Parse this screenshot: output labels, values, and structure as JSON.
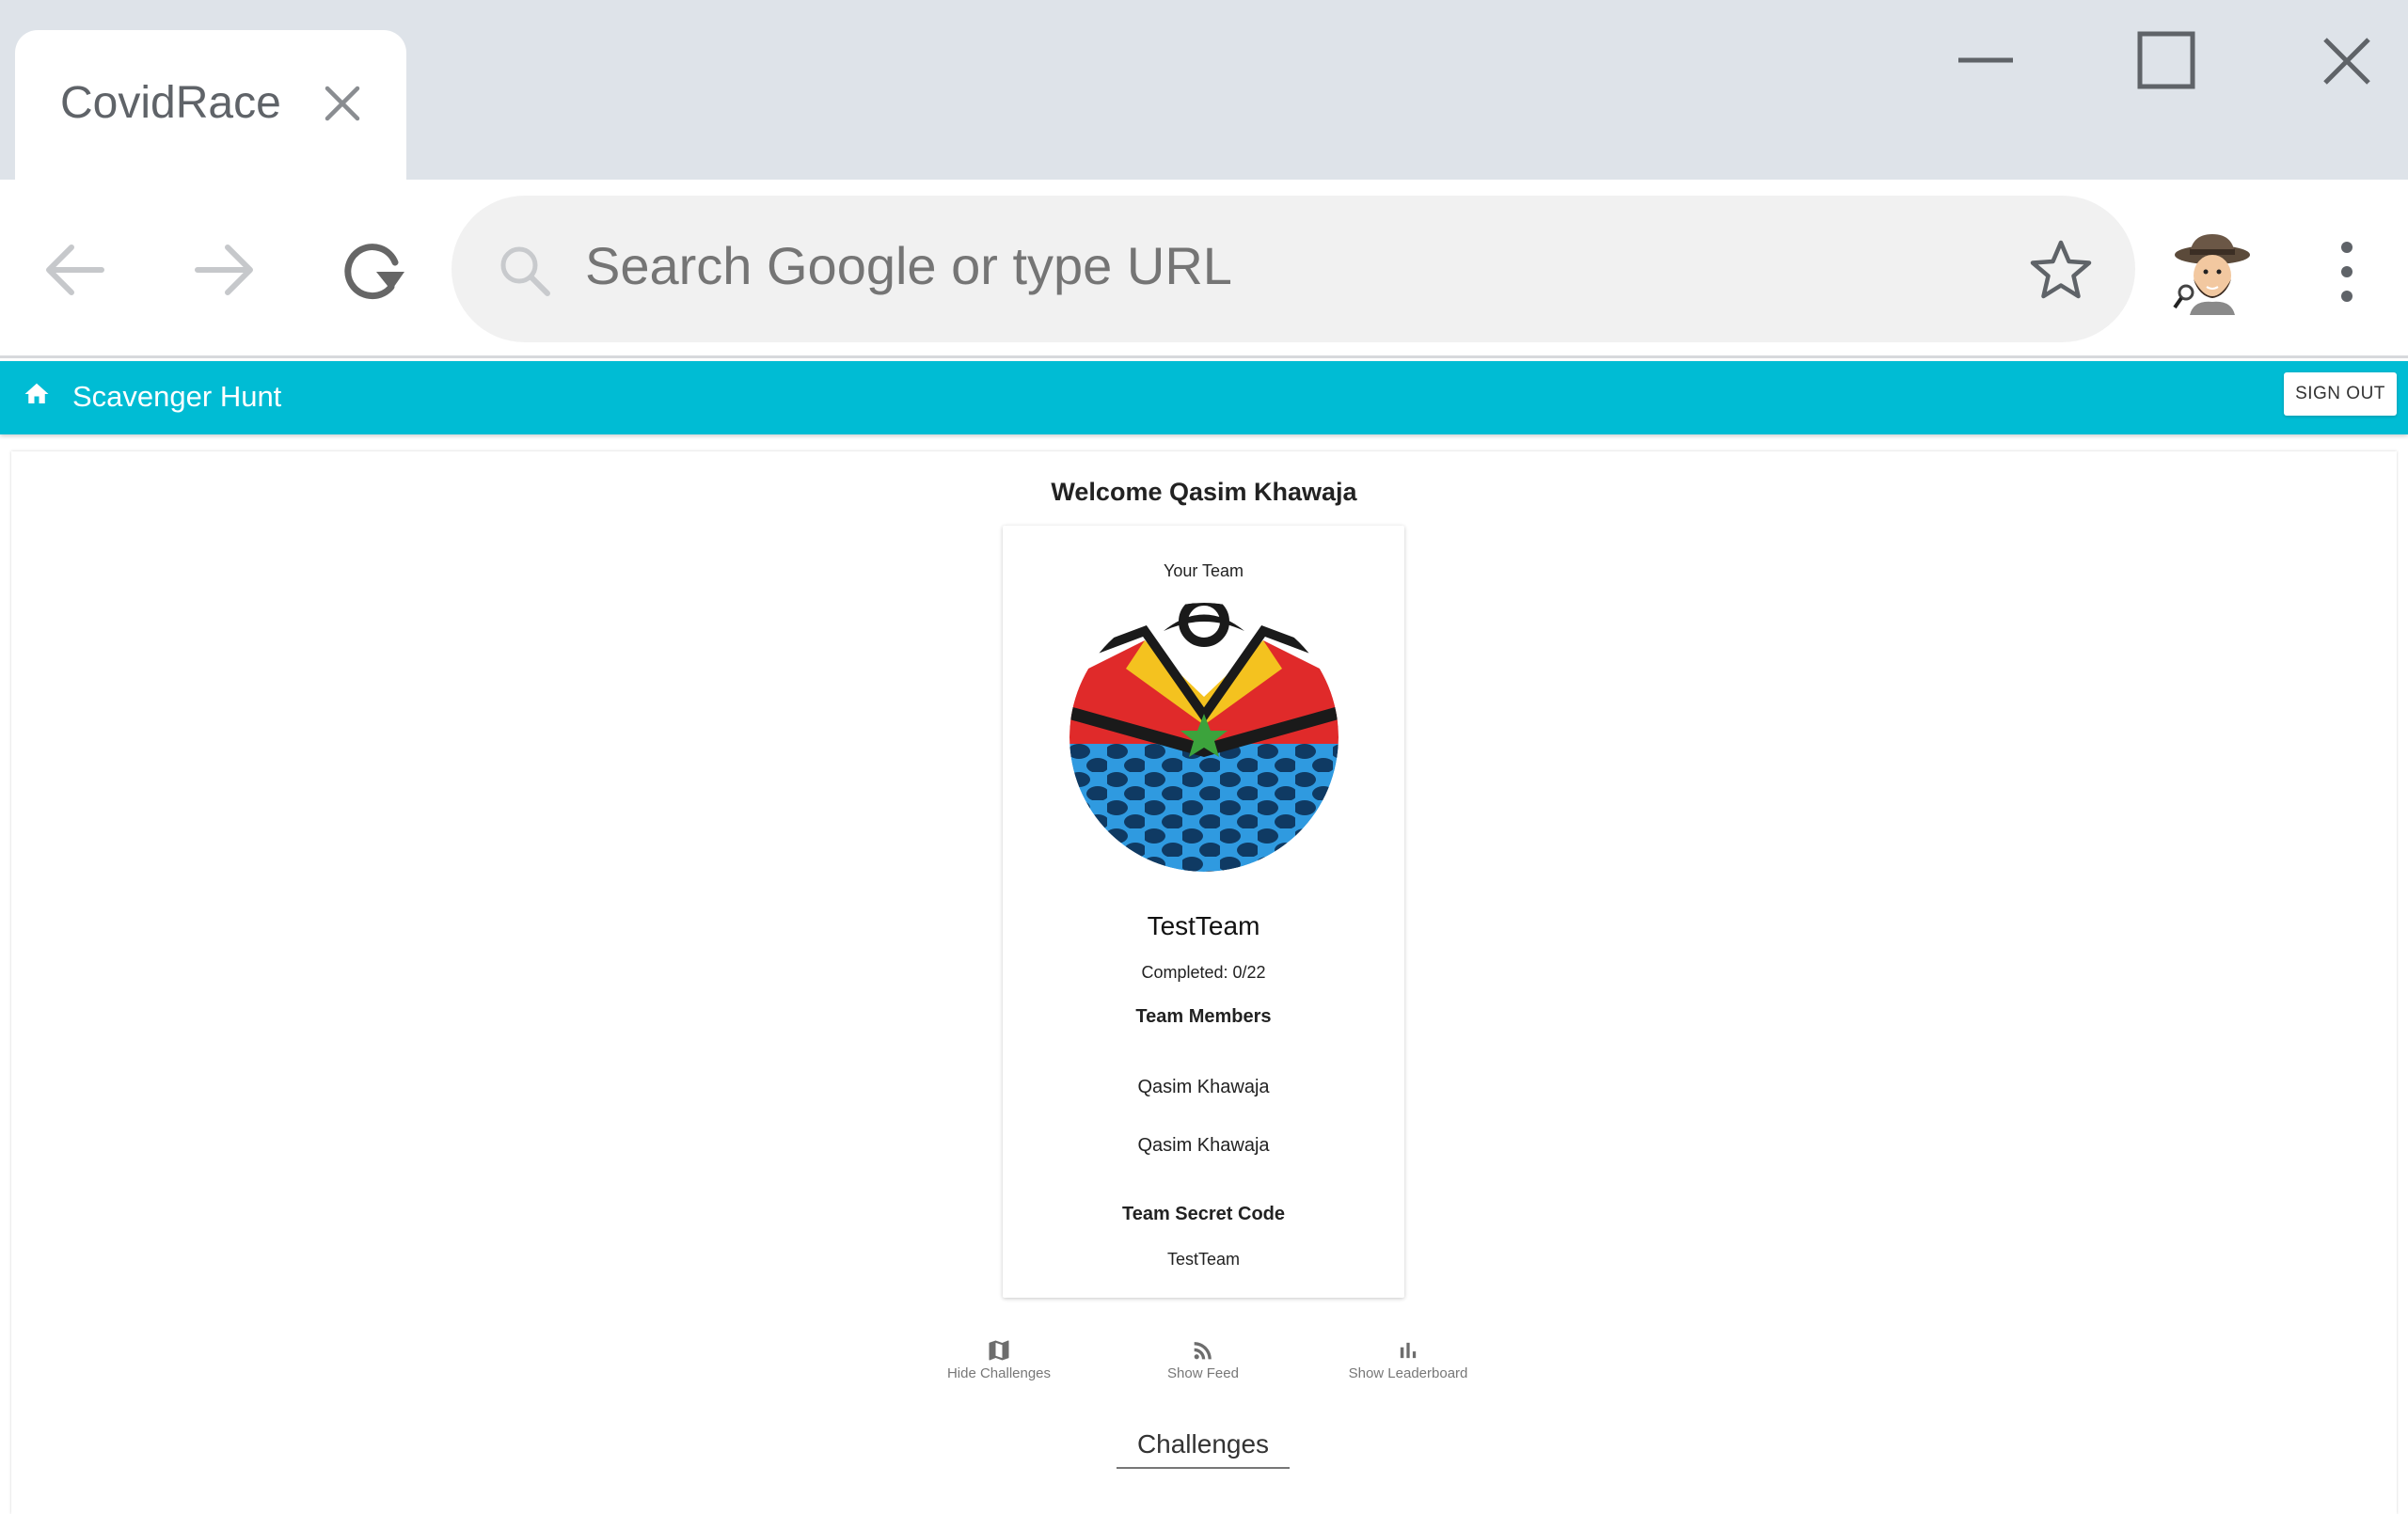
{
  "browser": {
    "tab_title": "CovidRace",
    "omnibox_placeholder": "Search Google or type URL"
  },
  "appbar": {
    "title": "Scavenger Hunt",
    "sign_out_label": "SIGN OUT",
    "color": "#00bcd4"
  },
  "page": {
    "welcome": "Welcome Qasim Khawaja",
    "team_card": {
      "caption": "Your Team",
      "team_name": "TestTeam",
      "completed": "Completed: 0/22",
      "members_heading": "Team Members",
      "members": [
        "Qasim Khawaja",
        "Qasim Khawaja"
      ],
      "secret_heading": "Team Secret Code",
      "secret_code": "TestTeam"
    },
    "bottom_nav": [
      {
        "label": "Hide Challenges",
        "icon": "map-icon"
      },
      {
        "label": "Show Feed",
        "icon": "rss-feed-icon"
      },
      {
        "label": "Show Leaderboard",
        "icon": "bar-chart-icon"
      }
    ],
    "challenges_heading": "Challenges"
  }
}
